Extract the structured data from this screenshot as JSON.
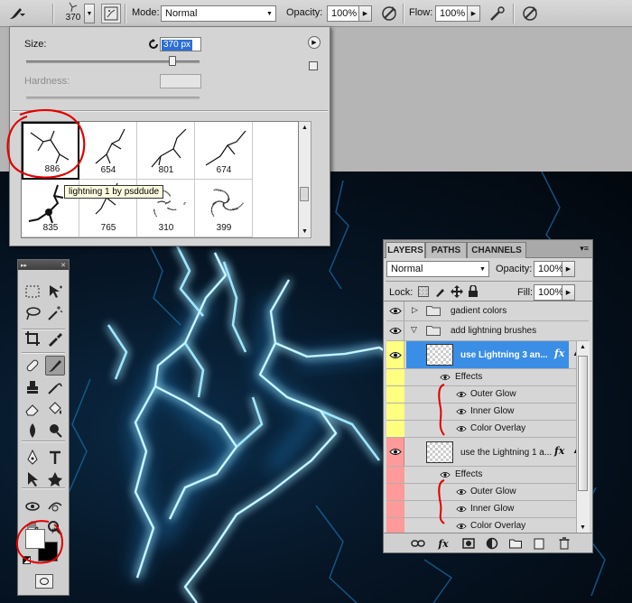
{
  "options_bar": {
    "brush_size": "370",
    "mode_label": "Mode:",
    "mode_value": "Normal",
    "opacity_label": "Opacity:",
    "opacity_value": "100%",
    "flow_label": "Flow:",
    "flow_value": "100%"
  },
  "brush_picker": {
    "size_label": "Size:",
    "size_value": "370 px",
    "hardness_label": "Hardness:",
    "brushes": [
      "886",
      "654",
      "801",
      "674",
      "835",
      "765",
      "310",
      "399"
    ],
    "tooltip": "lightning 1 by psddude"
  },
  "layers_panel": {
    "tabs": [
      "LAYERS",
      "PATHS",
      "CHANNELS"
    ],
    "blend_mode": "Normal",
    "opacity_label": "Opacity:",
    "opacity_value": "100%",
    "lock_label": "Lock:",
    "fill_label": "Fill:",
    "fill_value": "100%",
    "groups": [
      {
        "name": "gadient colors",
        "expanded": false
      },
      {
        "name": "add lightning brushes",
        "expanded": true
      }
    ],
    "layers": [
      {
        "name": "use Lightning 3 an...",
        "fx": "fx",
        "color_tag": "#ffff80",
        "selected": true,
        "effects_label": "Effects",
        "effects": [
          "Outer Glow",
          "Inner Glow",
          "Color Overlay"
        ]
      },
      {
        "name": "use the Lightning 1 a...",
        "fx": "fx",
        "color_tag": "#ff9a9a",
        "selected": false,
        "effects_label": "Effects",
        "effects": [
          "Outer Glow",
          "Inner Glow",
          "Color Overlay"
        ]
      }
    ],
    "footer_fx": "fx"
  },
  "colors": {
    "accent_selected": "#3a8ee6",
    "lightning": "#7fd8ff",
    "annotation_red": "#e00000",
    "foreground_swatch": "#ffffff",
    "background_swatch": "#000000"
  }
}
